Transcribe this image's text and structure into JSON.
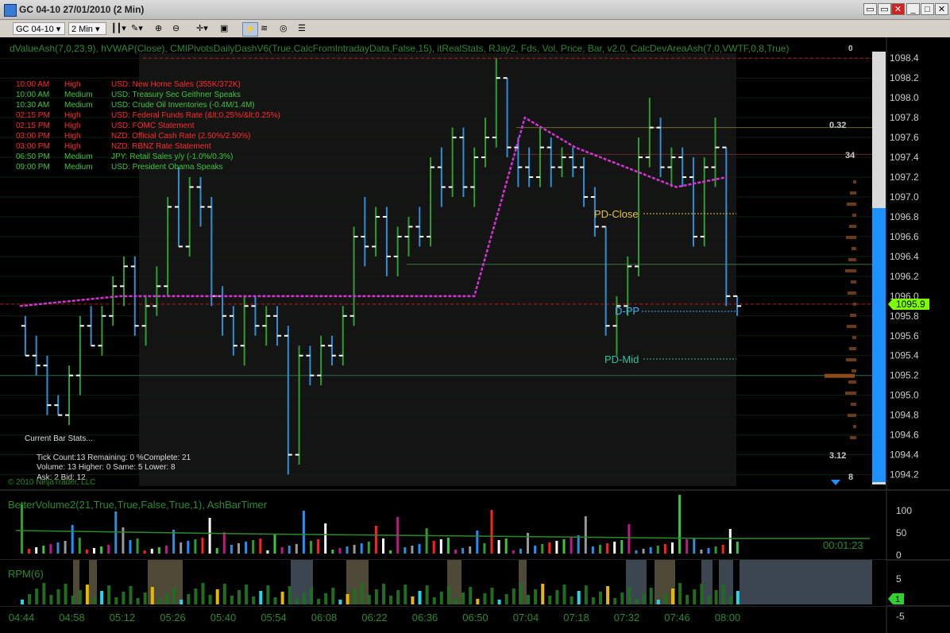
{
  "window": {
    "title": "GC 04-10  27/01/2010 (2 Min)",
    "buttons": [
      "▭",
      "▭",
      "✕",
      "_",
      "□",
      "✕"
    ]
  },
  "toolbar": {
    "instrument": "GC 04-10",
    "period": "2 Min"
  },
  "indicator_header": "dValueAsh(7,0,23,9), hVWAP(Close), CMIPivotsDailyDashV6(True,CalcFromIntradayData,False,15), itRealStats, RJay2, Fds, Vol, Price, Bar, v2.0, CalcDevAreaAsh(7,0,VWTF,0,8,True)",
  "news": [
    {
      "time": "10:00 AM",
      "impact": "High",
      "event": "USD: New Home Sales (355K/372K)",
      "color": "#ff2a2a"
    },
    {
      "time": "10:00 AM",
      "impact": "Medium",
      "event": "USD: Treasury Sec Geithner Speaks",
      "color": "#3ec43e"
    },
    {
      "time": "10:30 AM",
      "impact": "Medium",
      "event": "USD: Crude Oil Inventories (-0.4M/1.4M)",
      "color": "#3ec43e"
    },
    {
      "time": "02:15 PM",
      "impact": "High",
      "event": "USD: Federal Funds Rate (&lt;0.25%/&lt;0.25%)",
      "color": "#ff2a2a"
    },
    {
      "time": "02:15 PM",
      "impact": "High",
      "event": "USD: FOMC Statement",
      "color": "#ff2a2a"
    },
    {
      "time": "03:00 PM",
      "impact": "High",
      "event": "NZD: Official Cash Rate (2.50%/2.50%)",
      "color": "#ff2a2a"
    },
    {
      "time": "03:00 PM",
      "impact": "High",
      "event": "NZD: RBNZ Rate Statement",
      "color": "#ff2a2a"
    },
    {
      "time": "06:50 PM",
      "impact": "Medium",
      "event": "JPY: Retail Sales y/y (-1.0%/0.3%)",
      "color": "#3ec43e"
    },
    {
      "time": "09:00 PM",
      "impact": "Medium",
      "event": "USD: President Obama Speaks",
      "color": "#3ec43e"
    }
  ],
  "bar_stats": {
    "title": "Current Bar Stats...",
    "line1": "Tick Count:13   Remaining: 0   %Complete: 21",
    "line2": "Volume: 13   Higher: 0   Same: 5   Lower: 8",
    "line3": "Ask: 2   Bid: 12"
  },
  "copyright": "© 2010 NinjaTrader, LLC",
  "levels": {
    "pd_close": "PD-Close",
    "d_pp": "D-PP",
    "pd_mid": "PD-Mid"
  },
  "price_axis": [
    "1098.4",
    "1098.2",
    "1098.0",
    "1097.8",
    "1097.6",
    "1097.4",
    "1097.2",
    "1097.0",
    "1096.8",
    "1096.6",
    "1096.4",
    "1096.2",
    "1096.0",
    "1095.8",
    "1095.6",
    "1095.4",
    "1095.2",
    "1095.0",
    "1094.8",
    "1094.6",
    "1094.4",
    "1094.2"
  ],
  "current_price": "1095.9",
  "right_stats": {
    "top_value": "0.32",
    "val34": "34",
    "bottom_value": "3.12",
    "val8": "8",
    "top_num": "0"
  },
  "volume_panel": {
    "title": "BetterVolume2(21,True,True,False,True,1), AshBarTimer",
    "timer": "00:01:23",
    "axis": [
      "100",
      "50",
      "0"
    ]
  },
  "rpm_panel": {
    "title": "RPM(6)",
    "axis": [
      "5",
      "0",
      "-5"
    ],
    "current": "1"
  },
  "time_axis": [
    "04:44",
    "04:58",
    "05:12",
    "05:26",
    "05:40",
    "05:54",
    "06:08",
    "06:22",
    "06:36",
    "06:50",
    "07:04",
    "07:18",
    "07:32",
    "07:46",
    "08:00"
  ],
  "colors": {
    "up": "#2e9e2e",
    "down": "#2e8fd6",
    "vwap": "#d633d6",
    "accent_blue": "#1e90ff",
    "price_badge": "#7cfc00"
  },
  "chart_data": {
    "type": "candlestick",
    "x_labels": [
      "04:44",
      "04:58",
      "05:12",
      "05:26",
      "05:40",
      "05:54",
      "06:08",
      "06:22",
      "06:36",
      "06:50",
      "07:04",
      "07:18",
      "07:32",
      "07:46",
      "08:00"
    ],
    "ylim": [
      1094.1,
      1098.45
    ],
    "ohlc_approx": [
      [
        1095.7,
        1095.8,
        1095.4,
        1095.4
      ],
      [
        1095.4,
        1095.6,
        1095.2,
        1095.3
      ],
      [
        1095.3,
        1095.4,
        1094.8,
        1094.9
      ],
      [
        1094.9,
        1095.0,
        1094.8,
        1094.8
      ],
      [
        1094.8,
        1095.3,
        1094.7,
        1095.2
      ],
      [
        1095.2,
        1095.8,
        1095.0,
        1095.7
      ],
      [
        1095.7,
        1095.9,
        1095.5,
        1095.5
      ],
      [
        1095.5,
        1095.9,
        1095.4,
        1095.8
      ],
      [
        1095.8,
        1096.2,
        1095.7,
        1096.1
      ],
      [
        1096.1,
        1096.4,
        1095.9,
        1096.3
      ],
      [
        1096.3,
        1096.4,
        1095.6,
        1095.7
      ],
      [
        1095.7,
        1096.0,
        1095.5,
        1095.9
      ],
      [
        1095.9,
        1096.3,
        1095.8,
        1096.1
      ],
      [
        1096.1,
        1097.0,
        1096.0,
        1096.9
      ],
      [
        1096.9,
        1097.3,
        1096.5,
        1096.5
      ],
      [
        1096.5,
        1097.2,
        1096.4,
        1097.1
      ],
      [
        1097.1,
        1097.2,
        1096.7,
        1096.9
      ],
      [
        1096.9,
        1097.0,
        1095.9,
        1096.0
      ],
      [
        1096.0,
        1096.1,
        1095.6,
        1095.8
      ],
      [
        1095.8,
        1095.9,
        1095.4,
        1095.5
      ],
      [
        1095.5,
        1096.0,
        1095.3,
        1095.9
      ],
      [
        1095.9,
        1096.0,
        1095.6,
        1095.7
      ],
      [
        1095.7,
        1095.9,
        1095.5,
        1095.8
      ],
      [
        1095.8,
        1095.9,
        1095.5,
        1095.6
      ],
      [
        1095.6,
        1095.7,
        1094.2,
        1094.4
      ],
      [
        1094.4,
        1095.5,
        1094.3,
        1095.4
      ],
      [
        1095.4,
        1095.5,
        1095.1,
        1095.2
      ],
      [
        1095.2,
        1095.6,
        1095.1,
        1095.5
      ],
      [
        1095.5,
        1095.6,
        1095.3,
        1095.4
      ],
      [
        1095.4,
        1095.9,
        1095.3,
        1095.8
      ],
      [
        1095.8,
        1096.7,
        1095.7,
        1096.6
      ],
      [
        1096.6,
        1097.0,
        1096.3,
        1096.5
      ],
      [
        1096.5,
        1096.9,
        1096.4,
        1096.8
      ],
      [
        1096.8,
        1096.9,
        1096.2,
        1096.4
      ],
      [
        1096.4,
        1096.7,
        1096.2,
        1096.6
      ],
      [
        1096.6,
        1096.8,
        1096.4,
        1096.7
      ],
      [
        1096.7,
        1096.9,
        1096.5,
        1096.6
      ],
      [
        1096.6,
        1097.4,
        1096.5,
        1097.3
      ],
      [
        1097.3,
        1097.5,
        1096.9,
        1097.1
      ],
      [
        1097.1,
        1097.7,
        1097.0,
        1097.6
      ],
      [
        1097.6,
        1097.7,
        1097.0,
        1097.1
      ],
      [
        1097.1,
        1097.5,
        1096.9,
        1097.4
      ],
      [
        1097.4,
        1097.8,
        1097.3,
        1097.6
      ],
      [
        1097.6,
        1098.4,
        1097.5,
        1098.2
      ],
      [
        1098.2,
        1098.2,
        1097.4,
        1097.5
      ],
      [
        1097.5,
        1097.6,
        1097.1,
        1097.3
      ],
      [
        1097.3,
        1097.5,
        1097.1,
        1097.2
      ],
      [
        1097.2,
        1097.7,
        1097.1,
        1097.5
      ],
      [
        1097.5,
        1097.6,
        1097.1,
        1097.3
      ],
      [
        1097.3,
        1097.5,
        1097.2,
        1097.4
      ],
      [
        1097.4,
        1097.5,
        1097.2,
        1097.3
      ],
      [
        1097.3,
        1097.4,
        1096.9,
        1097.0
      ],
      [
        1097.0,
        1097.1,
        1096.6,
        1096.7
      ],
      [
        1096.7,
        1096.7,
        1095.6,
        1095.7
      ],
      [
        1095.7,
        1096.0,
        1095.4,
        1095.9
      ],
      [
        1095.9,
        1096.4,
        1095.8,
        1096.3
      ],
      [
        1096.3,
        1097.6,
        1096.2,
        1097.4
      ],
      [
        1097.4,
        1098.0,
        1097.3,
        1097.7
      ],
      [
        1097.7,
        1097.8,
        1097.2,
        1097.3
      ],
      [
        1097.3,
        1097.5,
        1097.1,
        1097.4
      ],
      [
        1097.4,
        1097.5,
        1097.1,
        1097.2
      ],
      [
        1097.2,
        1097.4,
        1096.5,
        1096.6
      ],
      [
        1096.6,
        1097.4,
        1096.5,
        1097.3
      ],
      [
        1097.3,
        1097.8,
        1097.1,
        1097.5
      ],
      [
        1097.5,
        1097.5,
        1095.9,
        1096.0
      ],
      [
        1096.0,
        1096.0,
        1095.8,
        1095.9
      ]
    ],
    "series": [
      {
        "name": "hVWAP",
        "values": [
          1095.9,
          1095.95,
          1096.0,
          1096.0,
          1096.0,
          1096.0,
          1096.0,
          1096.0,
          1096.0,
          1096.0,
          1097.8,
          1097.5,
          1097.3,
          1097.1,
          1097.2
        ]
      }
    ]
  }
}
